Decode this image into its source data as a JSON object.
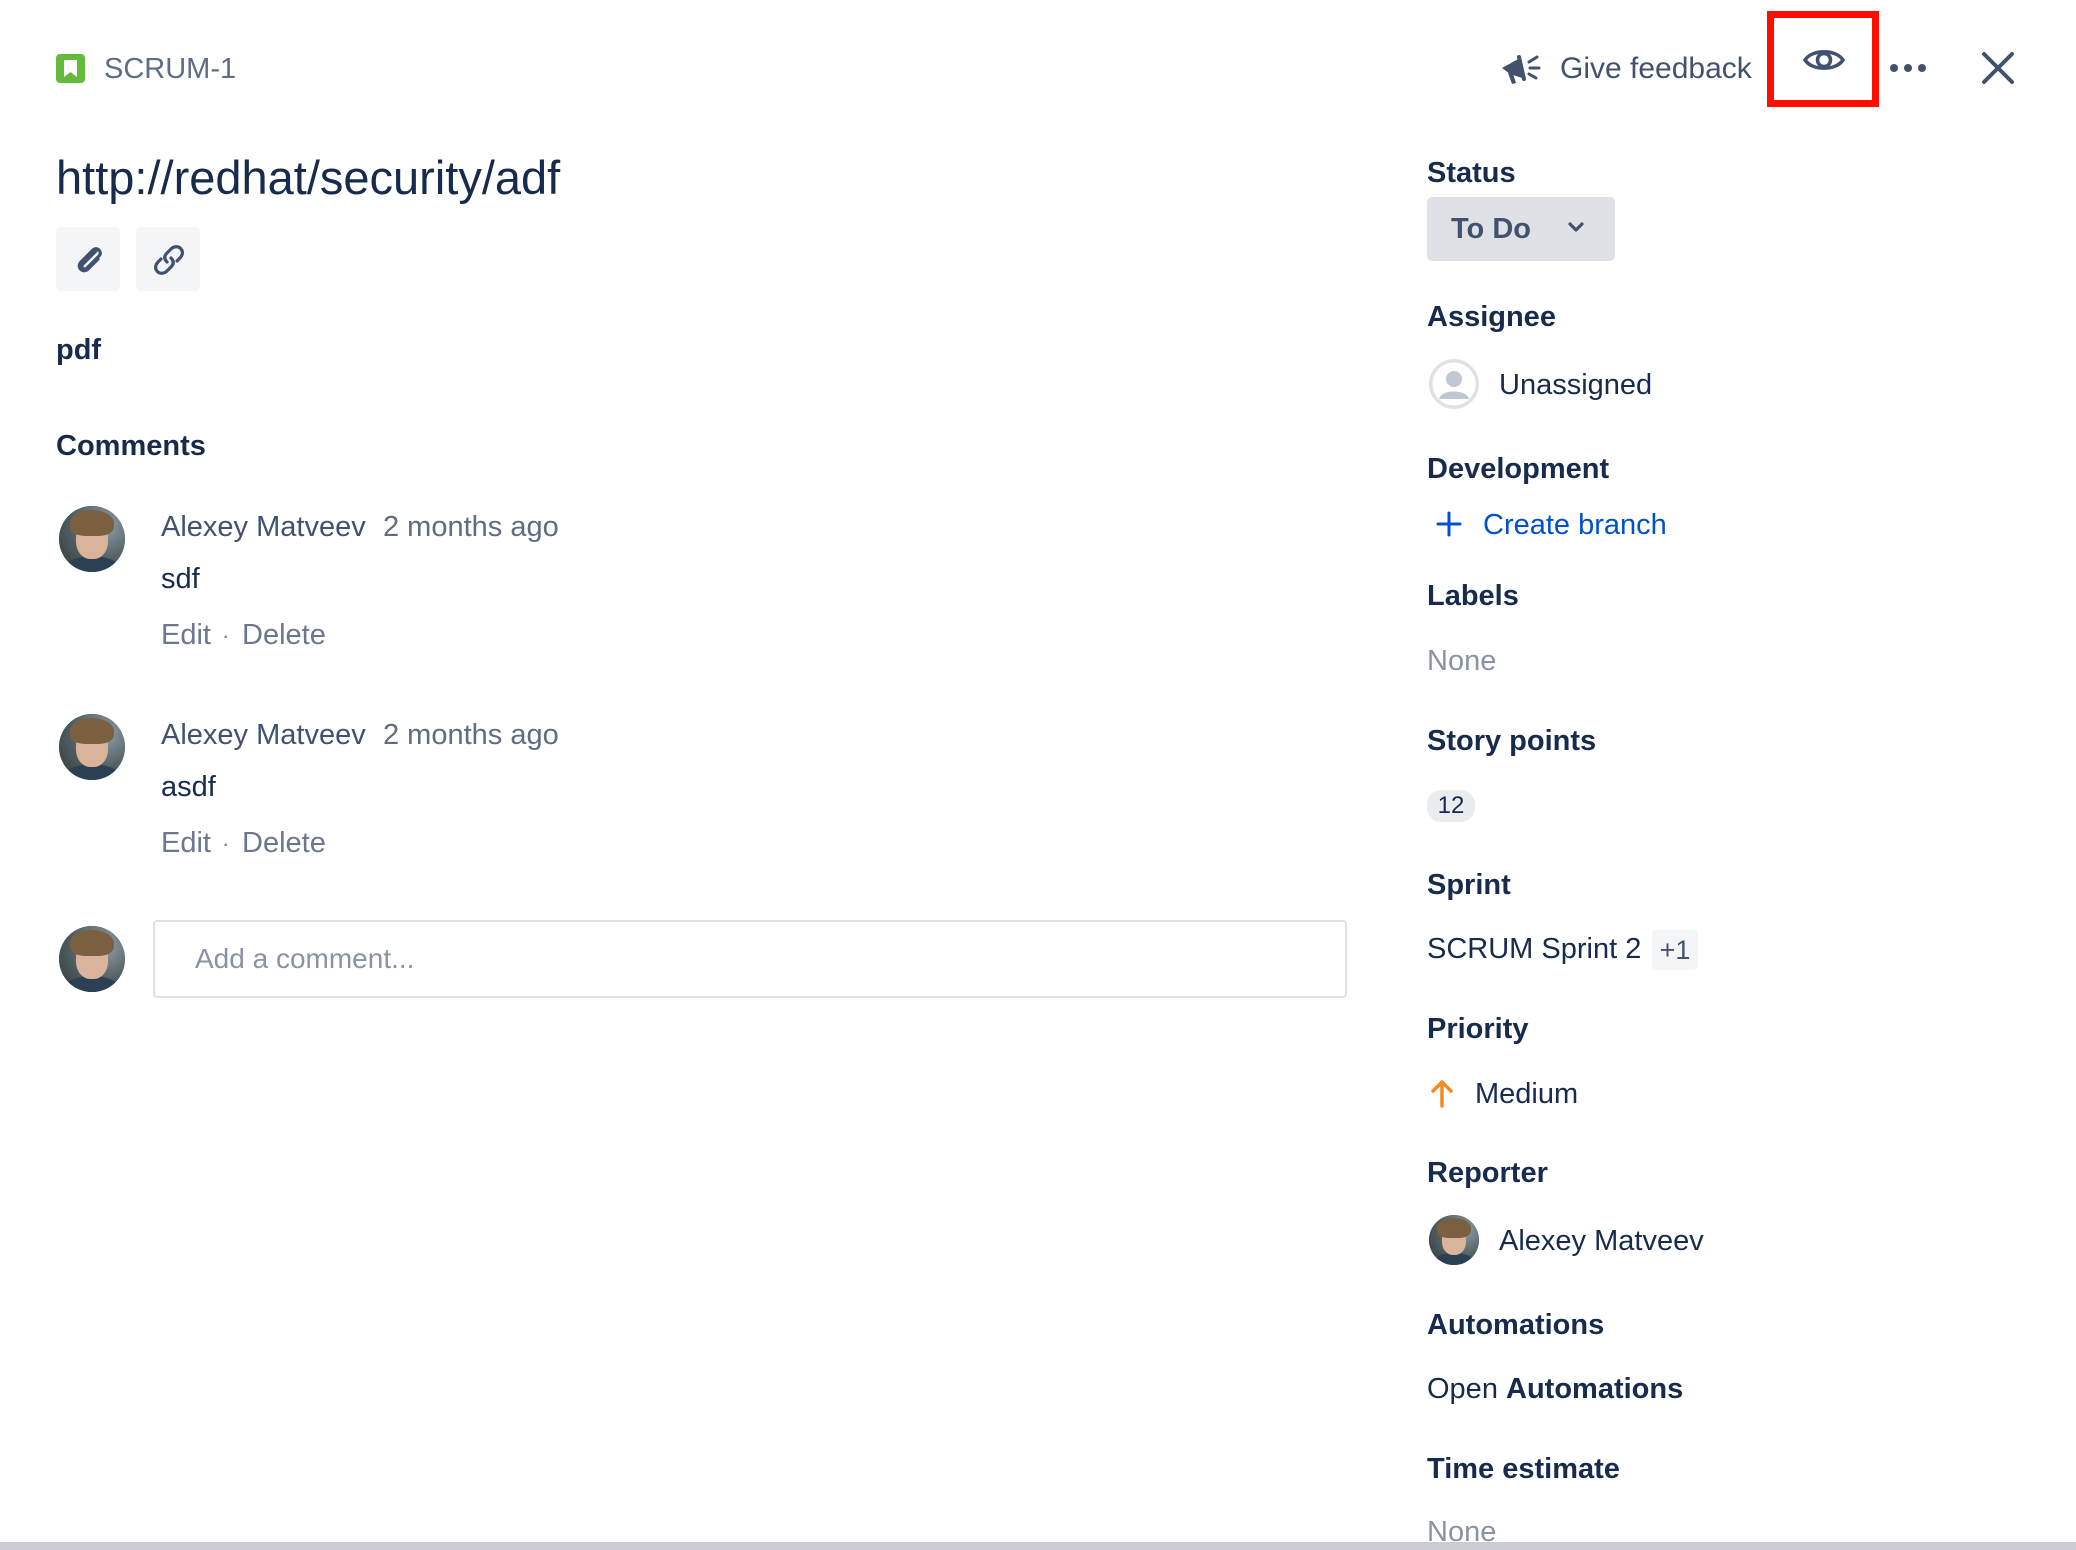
{
  "header": {
    "issue_key": "SCRUM-1",
    "feedback_label": "Give feedback",
    "icons": [
      "story-icon",
      "megaphone-icon",
      "eye-icon",
      "more-icon",
      "close-icon"
    ]
  },
  "issue": {
    "title": "http://redhat/security/adf",
    "description": "pdf"
  },
  "comments": {
    "heading": "Comments",
    "items": [
      {
        "author": "Alexey Matveev",
        "time": "2 months ago",
        "body": "sdf",
        "edit": "Edit",
        "separator": "·",
        "delete": "Delete"
      },
      {
        "author": "Alexey Matveev",
        "time": "2 months ago",
        "body": "asdf",
        "edit": "Edit",
        "separator": "·",
        "delete": "Delete"
      }
    ],
    "input_placeholder": "Add a comment..."
  },
  "fields": {
    "status": {
      "label": "Status",
      "value": "To Do"
    },
    "assignee": {
      "label": "Assignee",
      "value": "Unassigned"
    },
    "development": {
      "label": "Development",
      "action": "Create branch"
    },
    "labels": {
      "label": "Labels",
      "value": "None"
    },
    "story_points": {
      "label": "Story points",
      "value": "12"
    },
    "sprint": {
      "label": "Sprint",
      "value": "SCRUM Sprint 2",
      "extra": "+1"
    },
    "priority": {
      "label": "Priority",
      "value": "Medium"
    },
    "reporter": {
      "label": "Reporter",
      "value": "Alexey Matveev"
    },
    "automations": {
      "label": "Automations",
      "link_prefix": "Open",
      "link_bold": "Automations"
    },
    "time_estimate": {
      "label": "Time estimate",
      "value": "None"
    }
  },
  "colors": {
    "story": "#63ba3c",
    "highlight": "#ff0d00",
    "link": "#0052cc",
    "priority_medium": "#f18c22"
  }
}
